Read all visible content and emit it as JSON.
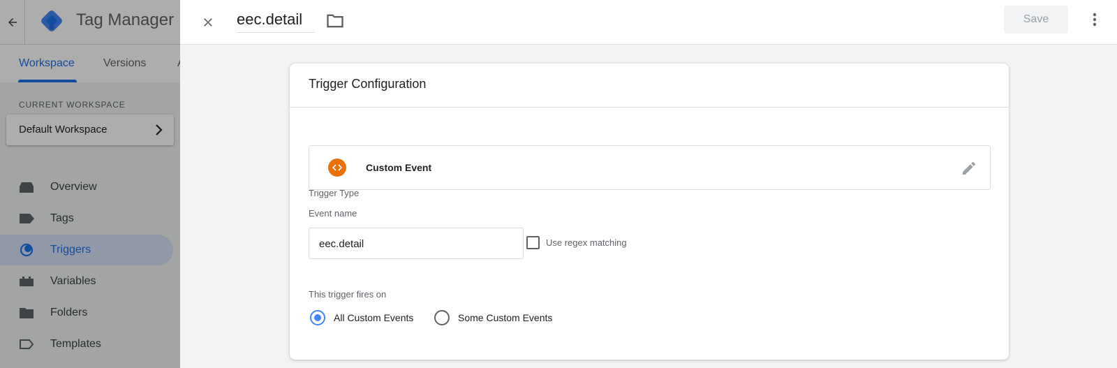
{
  "app": {
    "name": "Tag Manager",
    "nav_tabs": [
      {
        "label": "Workspace",
        "active": true
      },
      {
        "label": "Versions",
        "active": false
      },
      {
        "label": "A",
        "active": false
      }
    ],
    "current_workspace_label": "CURRENT WORKSPACE",
    "current_workspace_name": "Default Workspace",
    "sidebar_items": [
      {
        "label": "Overview",
        "icon": "overview-icon",
        "active": false
      },
      {
        "label": "Tags",
        "icon": "tag-icon",
        "active": false
      },
      {
        "label": "Triggers",
        "icon": "trigger-icon",
        "active": true
      },
      {
        "label": "Variables",
        "icon": "variables-icon",
        "active": false
      },
      {
        "label": "Folders",
        "icon": "folder-icon",
        "active": false
      },
      {
        "label": "Templates",
        "icon": "template-icon",
        "active": false
      }
    ]
  },
  "sheet": {
    "trigger_name": "eec.detail",
    "save_label": "Save",
    "card_title": "Trigger Configuration",
    "trigger_type_label": "Trigger Type",
    "trigger_type": "Custom Event",
    "event_name_label": "Event name",
    "event_name_value": "eec.detail",
    "regex_label": "Use regex matching",
    "regex_checked": false,
    "fires_on_label": "This trigger fires on",
    "fires_on_options": [
      {
        "label": "All Custom Events",
        "selected": true
      },
      {
        "label": "Some Custom Events",
        "selected": false
      }
    ]
  },
  "colors": {
    "accent": "#1a73e8",
    "radio_selected": "#4285f4",
    "custom_event_icon": "#e8710a",
    "sidebar_active_bg": "#d6e2f8"
  }
}
